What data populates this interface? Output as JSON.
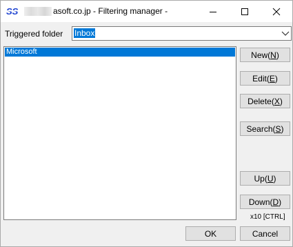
{
  "window": {
    "title": "asoft.co.jp - Filtering manager -",
    "icons": {
      "app": "app-logo-icon",
      "minimize": "minimize-icon",
      "maximize": "maximize-icon",
      "close": "close-icon"
    }
  },
  "folder": {
    "label": "Triggered folder",
    "selected": "Inbox",
    "dropdown_icon": "chevron-down-icon"
  },
  "filters": {
    "items": [
      "Microsoft"
    ],
    "selected_index": 0
  },
  "buttons": {
    "new_text": "New(",
    "new_key": "N",
    "new_end": ")",
    "edit_text": "Edit(",
    "edit_key": "E",
    "edit_end": ")",
    "delete_text": "Delete(",
    "delete_key": "X",
    "delete_end": ")",
    "search_text": "Search(",
    "search_key": "S",
    "search_end": ")",
    "up_text": "Up(",
    "up_key": "U",
    "up_end": ")",
    "down_text": "Down(",
    "down_key": "D",
    "down_end": ")",
    "ok": "OK",
    "cancel": "Cancel"
  },
  "hint": "x10 [CTRL]",
  "colors": {
    "selection": "#0078d7",
    "logo": "#1a3fcf"
  }
}
